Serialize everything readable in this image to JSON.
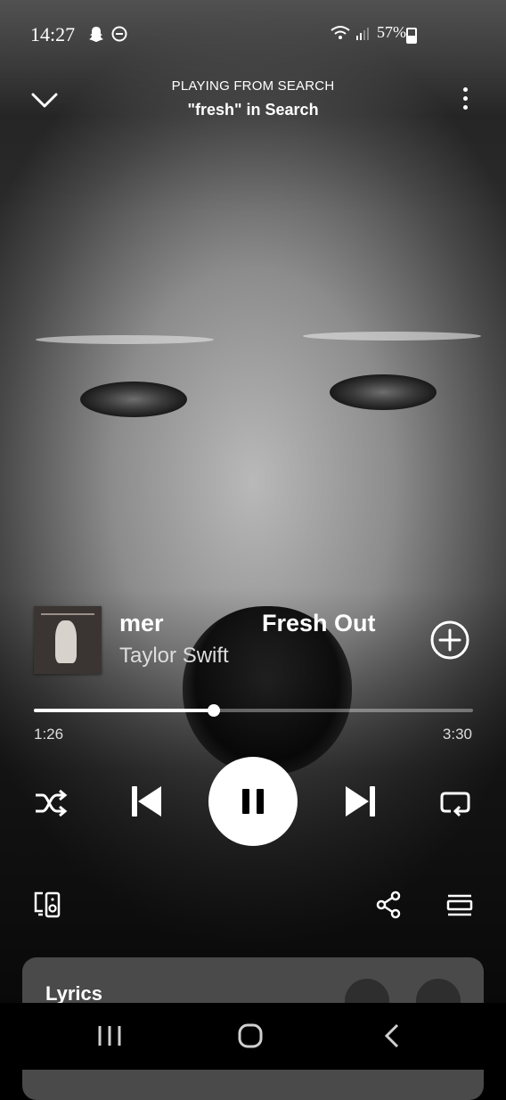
{
  "status_bar": {
    "time": "14:27",
    "battery": "57%"
  },
  "header": {
    "context_label": "PLAYING FROM SEARCH",
    "context_value": "\"fresh\" in Search"
  },
  "track": {
    "title_visible_start": "mer",
    "title_visible_end": "Fresh Out",
    "artist": "Taylor Swift"
  },
  "progress": {
    "elapsed": "1:26",
    "total": "3:30",
    "fraction": 0.41
  },
  "lyrics": {
    "label": "Lyrics"
  },
  "icons": {
    "collapse": "chevron-down-icon",
    "more": "more-vertical-icon",
    "add": "add-circle-icon",
    "shuffle": "shuffle-icon",
    "previous": "skip-previous-icon",
    "pause": "pause-icon",
    "next": "skip-next-icon",
    "repeat": "repeat-icon",
    "devices": "connect-device-icon",
    "share": "share-icon",
    "queue": "queue-icon"
  },
  "colors": {
    "accent": "#ffffff",
    "card": "#4a4a4a"
  }
}
